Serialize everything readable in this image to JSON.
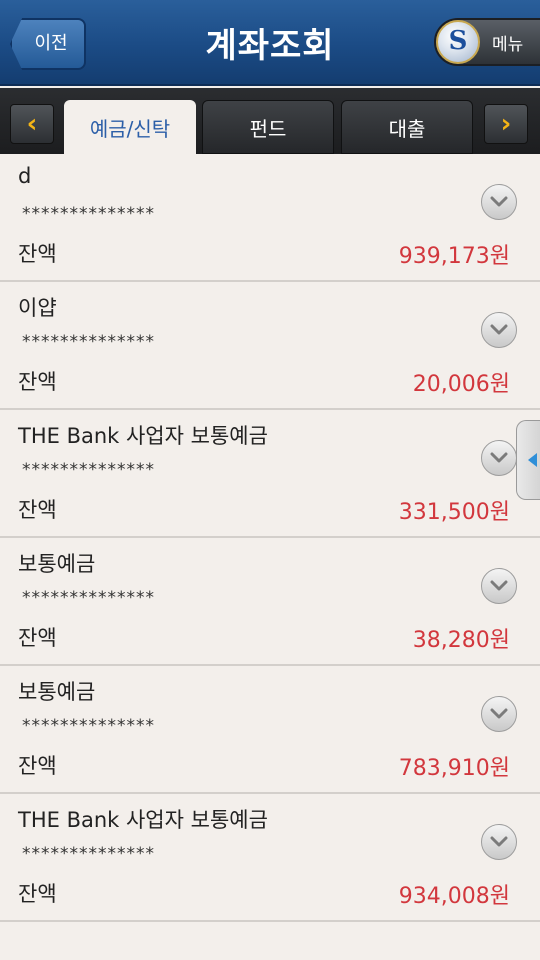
{
  "header": {
    "back_label": "이전",
    "title": "계좌조회",
    "menu_label": "메뉴",
    "logo_icon": "shinhan-logo-icon"
  },
  "tabs": [
    {
      "label": "예금/신탁",
      "active": true
    },
    {
      "label": "펀드",
      "active": false
    },
    {
      "label": "대출",
      "active": false
    }
  ],
  "accounts": [
    {
      "name": "d",
      "masked": "**************",
      "balance_label": "잔액",
      "amount": "939,173원"
    },
    {
      "name": "이얍",
      "masked": "**************",
      "balance_label": "잔액",
      "amount": "20,006원"
    },
    {
      "name": "THE Bank 사업자 보통예금",
      "masked": "**************",
      "balance_label": "잔액",
      "amount": "331,500원"
    },
    {
      "name": "보통예금",
      "masked": "**************",
      "balance_label": "잔액",
      "amount": "38,280원"
    },
    {
      "name": "보통예금",
      "masked": "**************",
      "balance_label": "잔액",
      "amount": "783,910원"
    },
    {
      "name": "THE Bank 사업자 보통예금",
      "masked": "**************",
      "balance_label": "잔액",
      "amount": "934,008원"
    }
  ],
  "colors": {
    "header_blue": "#1b4b85",
    "amount_red": "#d2373d",
    "active_tab_text": "#2c5fa8",
    "arrow_yellow": "#f4b416",
    "background": "#f3efeb"
  }
}
